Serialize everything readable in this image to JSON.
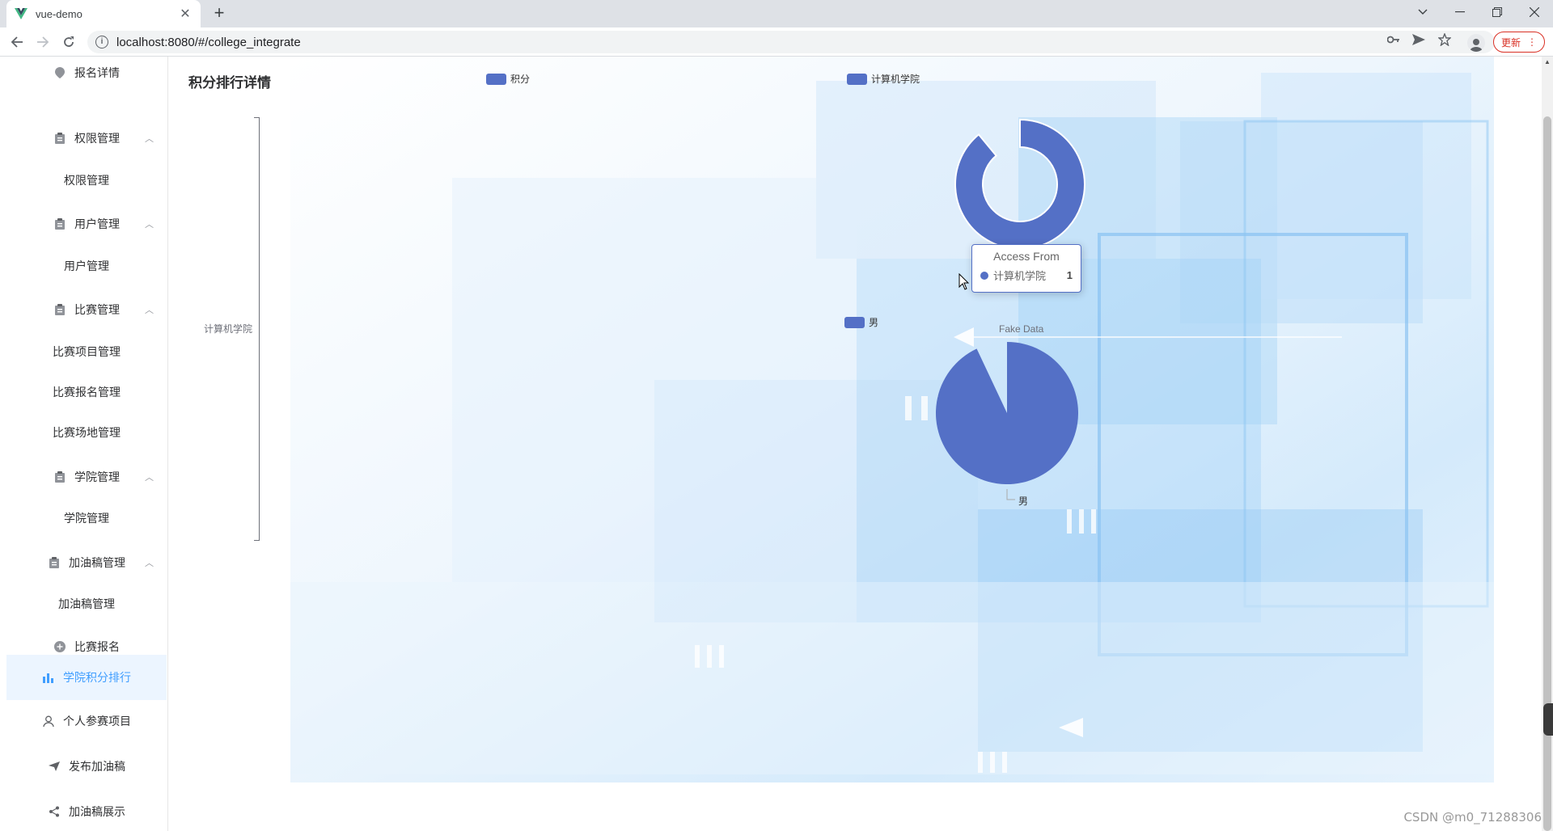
{
  "browser": {
    "tab_title": "vue-demo",
    "url": "localhost:8080/#/college_integrate",
    "update_label": "更新"
  },
  "sidebar": {
    "items": [
      {
        "label": "报名详情",
        "icon": "location-icon"
      },
      {
        "label": "权限管理",
        "icon": "clipboard-icon",
        "expanded": true,
        "children": [
          "权限管理"
        ]
      },
      {
        "label": "用户管理",
        "icon": "clipboard-icon",
        "expanded": true,
        "children": [
          "用户管理"
        ]
      },
      {
        "label": "比赛管理",
        "icon": "clipboard-icon",
        "expanded": true,
        "children": [
          "比赛项目管理",
          "比赛报名管理",
          "比赛场地管理"
        ]
      },
      {
        "label": "学院管理",
        "icon": "clipboard-icon",
        "expanded": true,
        "children": [
          "学院管理"
        ]
      },
      {
        "label": "加油稿管理",
        "icon": "clipboard-icon",
        "expanded": true,
        "children": [
          "加油稿管理"
        ]
      },
      {
        "label": "比赛报名",
        "icon": "plus-circle-icon"
      },
      {
        "label": "学院积分排行",
        "icon": "bar-chart-icon",
        "active": true
      },
      {
        "label": "个人参赛项目",
        "icon": "user-icon"
      },
      {
        "label": "发布加油稿",
        "icon": "send-icon"
      },
      {
        "label": "加油稿展示",
        "icon": "share-icon"
      }
    ]
  },
  "main": {
    "title": "积分排行详情"
  },
  "chart_data": [
    {
      "type": "bar",
      "orientation": "horizontal",
      "legend": [
        "积分"
      ],
      "categories": [
        "计算机学院"
      ],
      "series": [
        {
          "name": "积分",
          "values": [
            0
          ]
        }
      ]
    },
    {
      "type": "pie",
      "variant": "donut",
      "legend": [
        "计算机学院"
      ],
      "slices": [
        {
          "label": "计算机学院",
          "value": 1
        }
      ],
      "tooltip": {
        "title": "Access From",
        "label": "计算机学院",
        "value": "1"
      }
    },
    {
      "type": "pie",
      "title": "Fake Data",
      "legend": [
        "男"
      ],
      "slices": [
        {
          "label": "男",
          "value": 1
        }
      ]
    }
  ],
  "colors": {
    "accent": "#409eff",
    "series": "#5470c6"
  },
  "watermark": "CSDN @m0_71288306"
}
